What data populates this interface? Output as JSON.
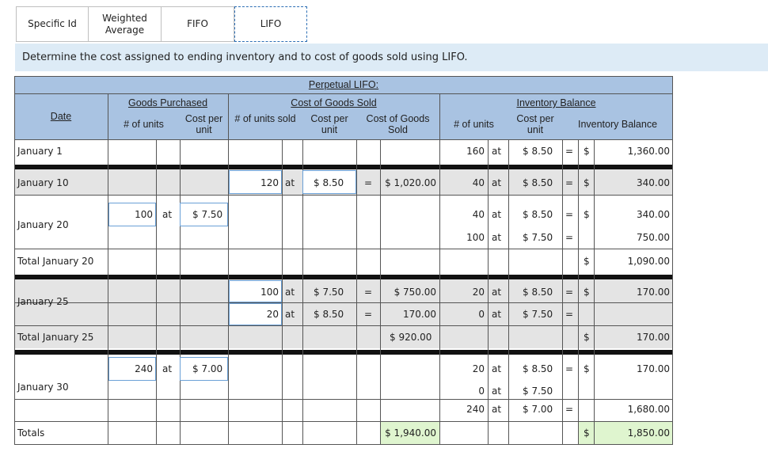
{
  "tabs": [
    {
      "label": "Specific Id"
    },
    {
      "label": "Weighted\nAverage"
    },
    {
      "label": "FIFO"
    },
    {
      "label": "LIFO"
    }
  ],
  "prompt": "Determine the cost assigned to ending inventory and to cost of goods sold using LIFO.",
  "headers": {
    "title": "Perpetual LIFO:",
    "date": "Date",
    "goods_purchased": "Goods Purchased",
    "cogs": "Cost of Goods Sold",
    "inv_balance": "Inventory Balance",
    "units": "# of units",
    "cost_per_unit": "Cost per unit",
    "units_sold": "# of units sold",
    "cost_of_goods_sold": "Cost of Goods Sold",
    "inventory_balance": "Inventory Balance"
  },
  "rows": {
    "jan1": {
      "date": "January 1",
      "bal_units": "160",
      "at": "at",
      "bal_cost": "$ 8.50",
      "eq": "=",
      "dollar": "$",
      "bal_total": "1,360.00"
    },
    "jan10": {
      "date": "January 10",
      "sold_units": "120",
      "at": "at",
      "sold_cost": "$ 8.50",
      "eq": "=",
      "sold_total": "$ 1,020.00",
      "bal_units": "40",
      "bal_cost": "$ 8.50",
      "dollar": "$",
      "bal_total": "340.00"
    },
    "jan20": {
      "date": "January 20",
      "pur_units": "100",
      "at": "at",
      "pur_cost": "$ 7.50",
      "bal": [
        {
          "units": "40",
          "cost": "$ 8.50",
          "eq": "=",
          "dollar": "$",
          "total": "340.00"
        },
        {
          "units": "100",
          "cost": "$ 7.50",
          "eq": "=",
          "dollar": "",
          "total": "750.00"
        }
      ]
    },
    "tot20": {
      "date": "Total January 20",
      "dollar": "$",
      "total": "1,090.00"
    },
    "jan25": {
      "date": "January 25",
      "sold": [
        {
          "units": "100",
          "cost": "$ 7.50",
          "eq": "=",
          "total": "$ 750.00"
        },
        {
          "units": "20",
          "cost": "$ 8.50",
          "eq": "=",
          "total": "170.00"
        }
      ],
      "bal": [
        {
          "units": "20",
          "cost": "$ 8.50",
          "eq": "=",
          "dollar": "$",
          "total": "170.00"
        },
        {
          "units": "0",
          "cost": "$ 7.50",
          "eq": "=",
          "dollar": "",
          "total": ""
        }
      ]
    },
    "tot25": {
      "date": "Total January 25",
      "sold_total": "$ 920.00",
      "dollar": "$",
      "total": "170.00"
    },
    "jan30": {
      "date": "January 30",
      "pur_units": "240",
      "at": "at",
      "pur_cost": "$ 7.00",
      "bal": [
        {
          "units": "20",
          "cost": "$ 8.50",
          "eq": "=",
          "dollar": "$",
          "total": "170.00"
        },
        {
          "units": "0",
          "cost": "$ 7.50",
          "eq": "",
          "dollar": "",
          "total": ""
        },
        {
          "units": "240",
          "cost": "$ 7.00",
          "eq": "=",
          "dollar": "",
          "total": "1,680.00"
        }
      ]
    },
    "totals": {
      "date": "Totals",
      "sold_total": "$ 1,940.00",
      "dollar": "$",
      "total": "1,850.00"
    }
  },
  "colors": {
    "header": "#a9c3e2",
    "prompt_bg": "#ddebf6",
    "answer_bg": "#dff5cf",
    "row_gray": "#e4e4e4",
    "input_border": "#6aa0d6"
  }
}
